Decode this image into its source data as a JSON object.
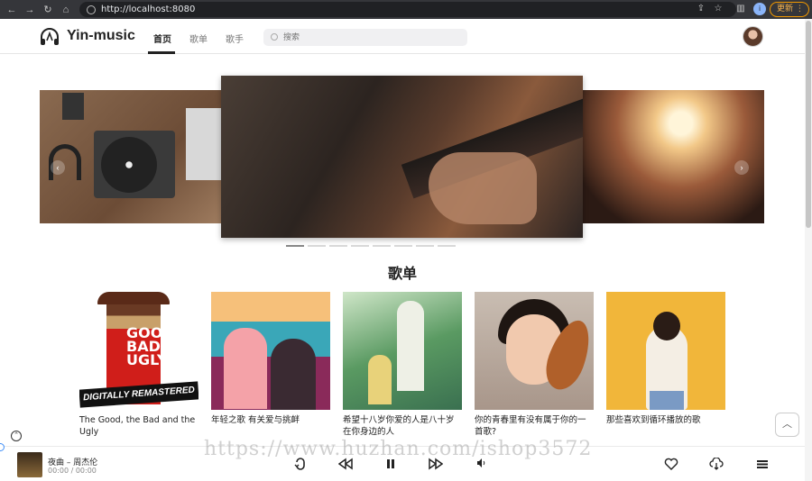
{
  "browser": {
    "url": "http://localhost:8080",
    "profile_letter": "i",
    "update_label": "更新"
  },
  "header": {
    "logo_text": "Yin-music",
    "tabs": [
      {
        "label": "首页",
        "active": true
      },
      {
        "label": "歌单",
        "active": false
      },
      {
        "label": "歌手",
        "active": false
      }
    ],
    "search_placeholder": "搜索"
  },
  "carousel": {
    "slide_count": 8,
    "active_index": 0
  },
  "playlist_section": {
    "title": "歌单",
    "cards": [
      {
        "title": "The Good, the Bad and the Ugly",
        "cover_text": "GOOD BAD UGLY",
        "cover_banner": "DIGITALLY REMASTERED"
      },
      {
        "title": "年轻之歌 有关爱与挑衅"
      },
      {
        "title": "希望十八岁你爱的人是八十岁在你身边的人"
      },
      {
        "title": "你的青春里有没有属于你的一首歌?"
      },
      {
        "title": "那些喜欢到循环播放的歌"
      }
    ]
  },
  "player": {
    "song": "夜曲 – 周杰伦",
    "time": "00:00 / 00:00",
    "progress": 0
  },
  "watermark": "https://www.huzhan.com/ishop3572",
  "colors": {
    "accent": "#222222",
    "progress_knob": "#3f8ef7",
    "update_border": "#f29900"
  }
}
